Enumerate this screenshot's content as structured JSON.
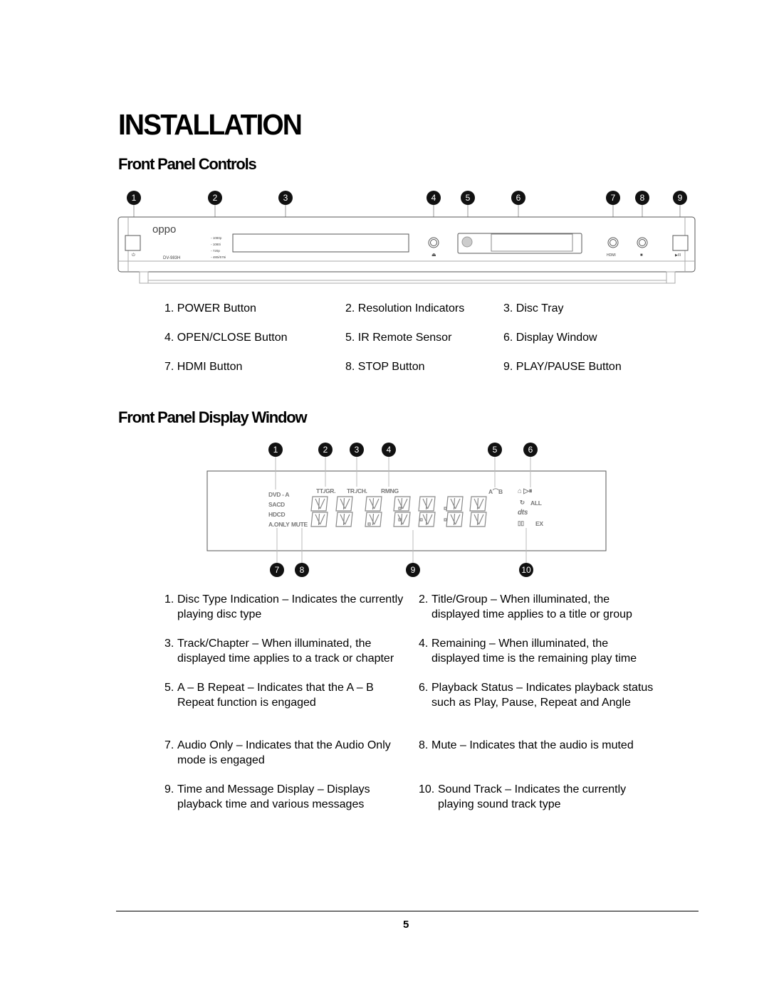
{
  "page_title": "INSTALLATION",
  "sections": {
    "controls": {
      "heading": "Front Panel Controls",
      "markers": [
        "1",
        "2",
        "3",
        "4",
        "5",
        "6",
        "7",
        "8",
        "9"
      ],
      "panel": {
        "brand": "oppo",
        "model": "DV-983H",
        "resolutions": [
          "1080p",
          "1080i",
          "720p",
          "480i/576i"
        ],
        "hdmi_label": "HDMI"
      },
      "items": [
        {
          "num": "1.",
          "label": "POWER Button"
        },
        {
          "num": "2.",
          "label": "Resolution Indicators"
        },
        {
          "num": "3.",
          "label": "Disc Tray"
        },
        {
          "num": "4.",
          "label": "OPEN/CLOSE Button"
        },
        {
          "num": "5.",
          "label": "IR Remote Sensor"
        },
        {
          "num": "6.",
          "label": "Display Window"
        },
        {
          "num": "7.",
          "label": "HDMI Button"
        },
        {
          "num": "8.",
          "label": "STOP Button"
        },
        {
          "num": "9.",
          "label": "PLAY/PAUSE Button"
        }
      ]
    },
    "display": {
      "heading": "Front Panel Display Window",
      "markers_top": [
        "1",
        "2",
        "3",
        "4",
        "5",
        "6"
      ],
      "markers_bottom": [
        "7",
        "8",
        "9",
        "10"
      ],
      "window_labels": {
        "dvda": "DVD - A",
        "sacd": "SACD",
        "hdcd": "HDCD",
        "aonly": "A.ONLY",
        "mute": "MUTE",
        "ttgr": "TT./GR.",
        "trch": "TR./CH.",
        "rmng": "RMNG",
        "ab": "A⌒B",
        "all": "ALL",
        "dts": "dts",
        "ex": "EX"
      },
      "items": [
        {
          "num": "1.",
          "text": "Disc Type Indication – Indicates the currently playing disc type"
        },
        {
          "num": "2.",
          "text": "Title/Group – When illuminated, the displayed time applies to a title or group"
        },
        {
          "num": "3.",
          "text": "Track/Chapter – When illuminated, the displayed time applies to a track or chapter"
        },
        {
          "num": "4.",
          "text": "Remaining – When illuminated, the displayed time is the remaining play time"
        },
        {
          "num": "5.",
          "text": "A – B Repeat – Indicates that the A – B Repeat function is engaged"
        },
        {
          "num": "6.",
          "text": "Playback Status – Indicates playback status such as Play, Pause, Repeat and Angle"
        },
        {
          "num": "7.",
          "text": "Audio Only – Indicates that the Audio Only mode is engaged"
        },
        {
          "num": "8.",
          "text": "Mute – Indicates that the audio is muted"
        },
        {
          "num": "9.",
          "text": "Time and Message Display – Displays playback time and various messages"
        },
        {
          "num": "10.",
          "text": "Sound Track – Indicates the currently playing sound track type"
        }
      ]
    }
  },
  "footer": {
    "page_number": "5"
  }
}
